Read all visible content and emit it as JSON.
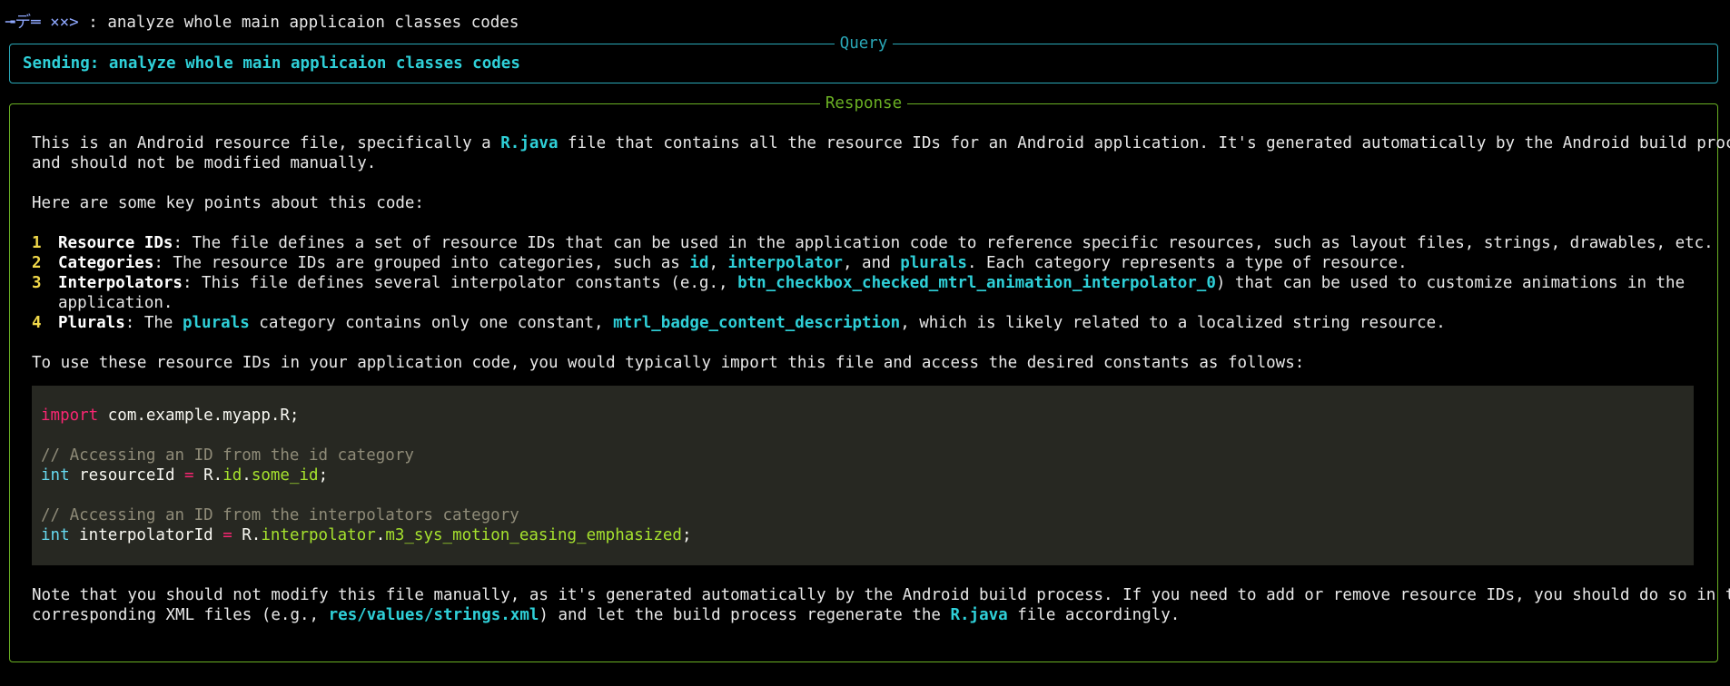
{
  "prompt": {
    "prefix": "╼デ═ ××>",
    "text": " : analyze whole main applicaion classes codes"
  },
  "query": {
    "title": "Query",
    "sending": "Sending: analyze whole main applicaion classes codes"
  },
  "response": {
    "title": "Response",
    "intro_1": [
      "This is an Android resource file, specifically a ",
      "R.java",
      " file that contains all the resource IDs for an Android application. It's generated automatically by the Android build process"
    ],
    "intro_2": "and should not be modified manually.",
    "key_points_heading": "Here are some key points about this code:",
    "list": [
      {
        "num": "1",
        "term": "Resource IDs",
        "text": ": The file defines a set of resource IDs that can be used in the application code to reference specific resources, such as layout files, strings, drawables, etc."
      },
      {
        "num": "2",
        "term": "Categories",
        "parts": [
          ": The resource IDs are grouped into categories, such as ",
          "id",
          ", ",
          "interpolator",
          ", and ",
          "plurals",
          ". Each category represents a type of resource."
        ]
      },
      {
        "num": "3",
        "term": "Interpolators",
        "parts": [
          ": This file defines several interpolator constants (e.g., ",
          "btn_checkbox_checked_mtrl_animation_interpolator_0",
          ") that can be used to customize animations in the"
        ],
        "cont": "application."
      },
      {
        "num": "4",
        "term": "Plurals",
        "parts": [
          ": The ",
          "plurals",
          " category contains only one constant, ",
          "mtrl_badge_content_description",
          ", which is likely related to a localized string resource."
        ]
      }
    ],
    "usage": "To use these resource IDs in your application code, you would typically import this file and access the desired constants as follows:",
    "code": {
      "import_kw": "import",
      "import_rest": " com.example.myapp.R;",
      "comment_1": "// Accessing an ID from the id category",
      "line_1": {
        "type": "int",
        "name": " resourceId ",
        "op": "=",
        "obj": " R.",
        "attr1": "id",
        "dot": ".",
        "attr2": "some_id",
        "end": ";"
      },
      "comment_2": "// Accessing an ID from the interpolators category",
      "line_2": {
        "type": "int",
        "name": " interpolatorId ",
        "op": "=",
        "obj": " R.",
        "attr1": "interpolator",
        "dot": ".",
        "attr2": "m3_sys_motion_easing_emphasized",
        "end": ";"
      }
    },
    "note_1": "Note that you should not modify this file manually, as it's generated automatically by the Android build process. If you need to add or remove resource IDs, you should do so in the",
    "note_2": [
      "corresponding XML files (e.g., ",
      "res/values/strings.xml",
      ") and let the build process regenerate the ",
      "R.java",
      " file accordingly."
    ]
  }
}
